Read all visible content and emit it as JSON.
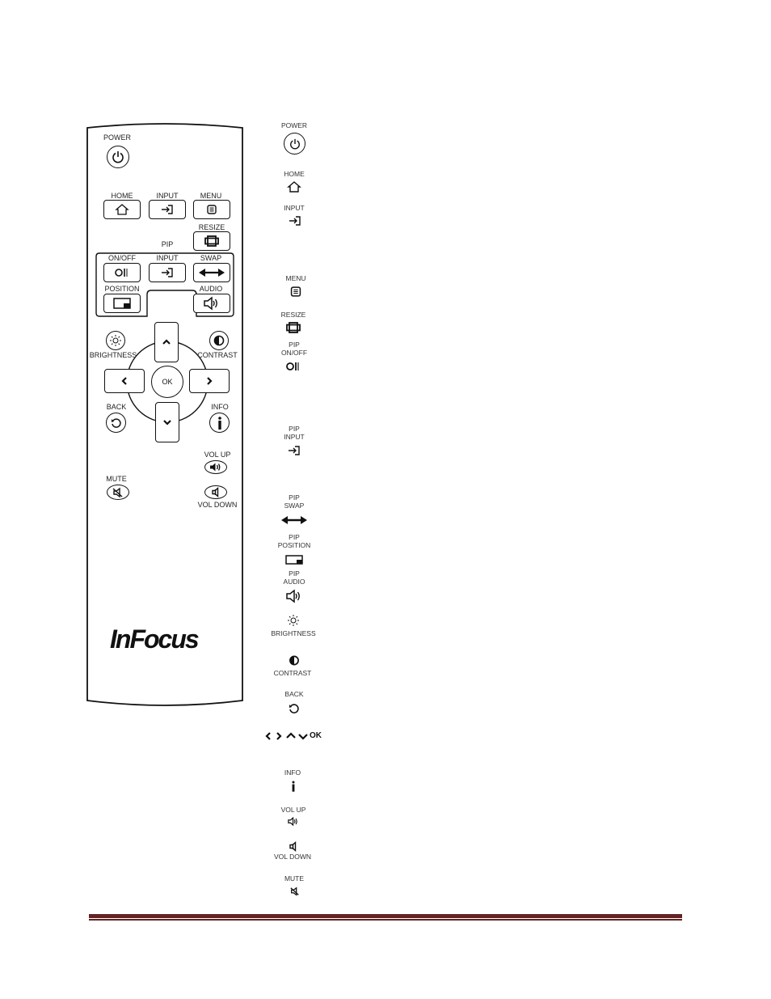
{
  "remote": {
    "power": "POWER",
    "home": "HOME",
    "input": "INPUT",
    "menu": "MENU",
    "resize": "RESIZE",
    "pip": "PIP",
    "pip_onoff": "ON/OFF",
    "pip_input": "INPUT",
    "pip_swap": "SWAP",
    "pip_position": "POSITION",
    "pip_audio": "AUDIO",
    "brightness": "BRIGHTNESS",
    "contrast": "CONTRAST",
    "ok": "OK",
    "back": "BACK",
    "info": "INFO",
    "vol_up": "VOL UP",
    "mute": "MUTE",
    "vol_down": "VOL DOWN",
    "brand": "InFocus"
  },
  "legend": {
    "power": "POWER",
    "home": "HOME",
    "input": "INPUT",
    "menu": "MENU",
    "resize": "RESIZE",
    "pip_onoff_1": "PIP",
    "pip_onoff_2": "ON/OFF",
    "pip_input_1": "PIP",
    "pip_input_2": "INPUT",
    "pip_swap_1": "PIP",
    "pip_swap_2": "SWAP",
    "pip_position_1": "PIP",
    "pip_position_2": "POSITION",
    "pip_audio_1": "PIP",
    "pip_audio_2": "AUDIO",
    "brightness": "BRIGHTNESS",
    "contrast": "CONTRAST",
    "back": "BACK",
    "nav_ok": "OK",
    "info": "INFO",
    "vol_up": "VOL UP",
    "vol_down": "VOL DOWN",
    "mute": "MUTE"
  },
  "colors": {
    "footer_rule": "#622423",
    "outline": "#111111"
  }
}
